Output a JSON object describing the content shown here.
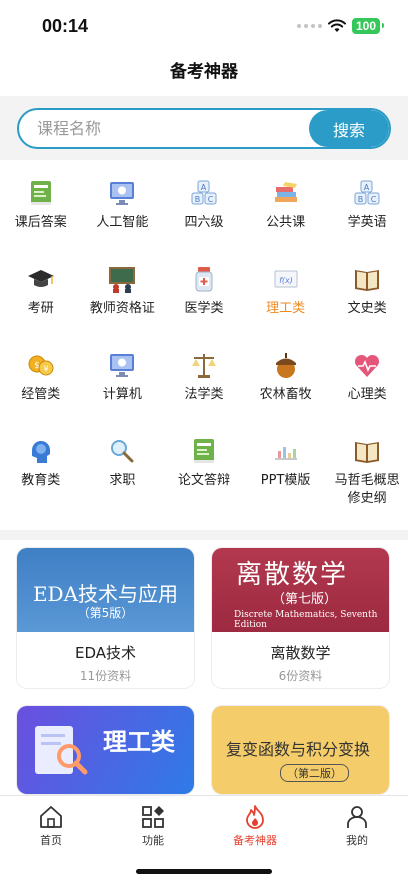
{
  "status": {
    "time": "00:14",
    "battery": "100"
  },
  "header": {
    "title": "备考神器"
  },
  "search": {
    "placeholder": "课程名称",
    "button_label": "搜索"
  },
  "categories": [
    {
      "label": "课后答案",
      "icon": "book-answer-icon"
    },
    {
      "label": "人工智能",
      "icon": "monitor-icon"
    },
    {
      "label": "四六级",
      "icon": "abc-blocks-icon"
    },
    {
      "label": "公共课",
      "icon": "books-stack-icon"
    },
    {
      "label": "学英语",
      "icon": "abc-blocks-icon"
    },
    {
      "label": "考研",
      "icon": "graduation-cap-icon"
    },
    {
      "label": "教师资格证",
      "icon": "teacher-board-icon"
    },
    {
      "label": "医学类",
      "icon": "medicine-jar-icon"
    },
    {
      "label": "理工类",
      "icon": "science-board-icon",
      "active": true
    },
    {
      "label": "文史类",
      "icon": "open-book-icon"
    },
    {
      "label": "经管类",
      "icon": "coins-icon"
    },
    {
      "label": "计算机",
      "icon": "monitor-icon"
    },
    {
      "label": "法学类",
      "icon": "scales-icon"
    },
    {
      "label": "农林畜牧",
      "icon": "acorn-icon"
    },
    {
      "label": "心理类",
      "icon": "heart-pulse-icon"
    },
    {
      "label": "教育类",
      "icon": "brain-head-icon"
    },
    {
      "label": "求职",
      "icon": "magnifier-icon"
    },
    {
      "label": "论文答辩",
      "icon": "book-answer-icon"
    },
    {
      "label": "PPT模版",
      "icon": "bar-chart-icon"
    },
    {
      "label": "马哲毛概思修史纲",
      "icon": "open-book-icon"
    }
  ],
  "cards": [
    {
      "title": "EDA技术",
      "count": "11份资料",
      "cover_text": "EDA技术与应用",
      "cover_sub": "（第5版）"
    },
    {
      "title": "离散数学",
      "count": "6份资料",
      "cover_text": "离散数学",
      "cover_sub": "（第七版）",
      "cover_en": "Discrete Mathematics, Seventh Edition"
    },
    {
      "cover_text": "理工类"
    },
    {
      "cover_text": "复变函数与积分变换",
      "cover_sub": "（第二版）"
    }
  ],
  "tabs": [
    {
      "label": "首页",
      "icon": "home-icon"
    },
    {
      "label": "功能",
      "icon": "grid-icon"
    },
    {
      "label": "备考神器",
      "icon": "flame-icon",
      "active": true
    },
    {
      "label": "我的",
      "icon": "person-icon"
    }
  ],
  "colors": {
    "accent": "#2b9bc7",
    "active_category": "#f08a1d",
    "active_tab": "#e5402f"
  }
}
